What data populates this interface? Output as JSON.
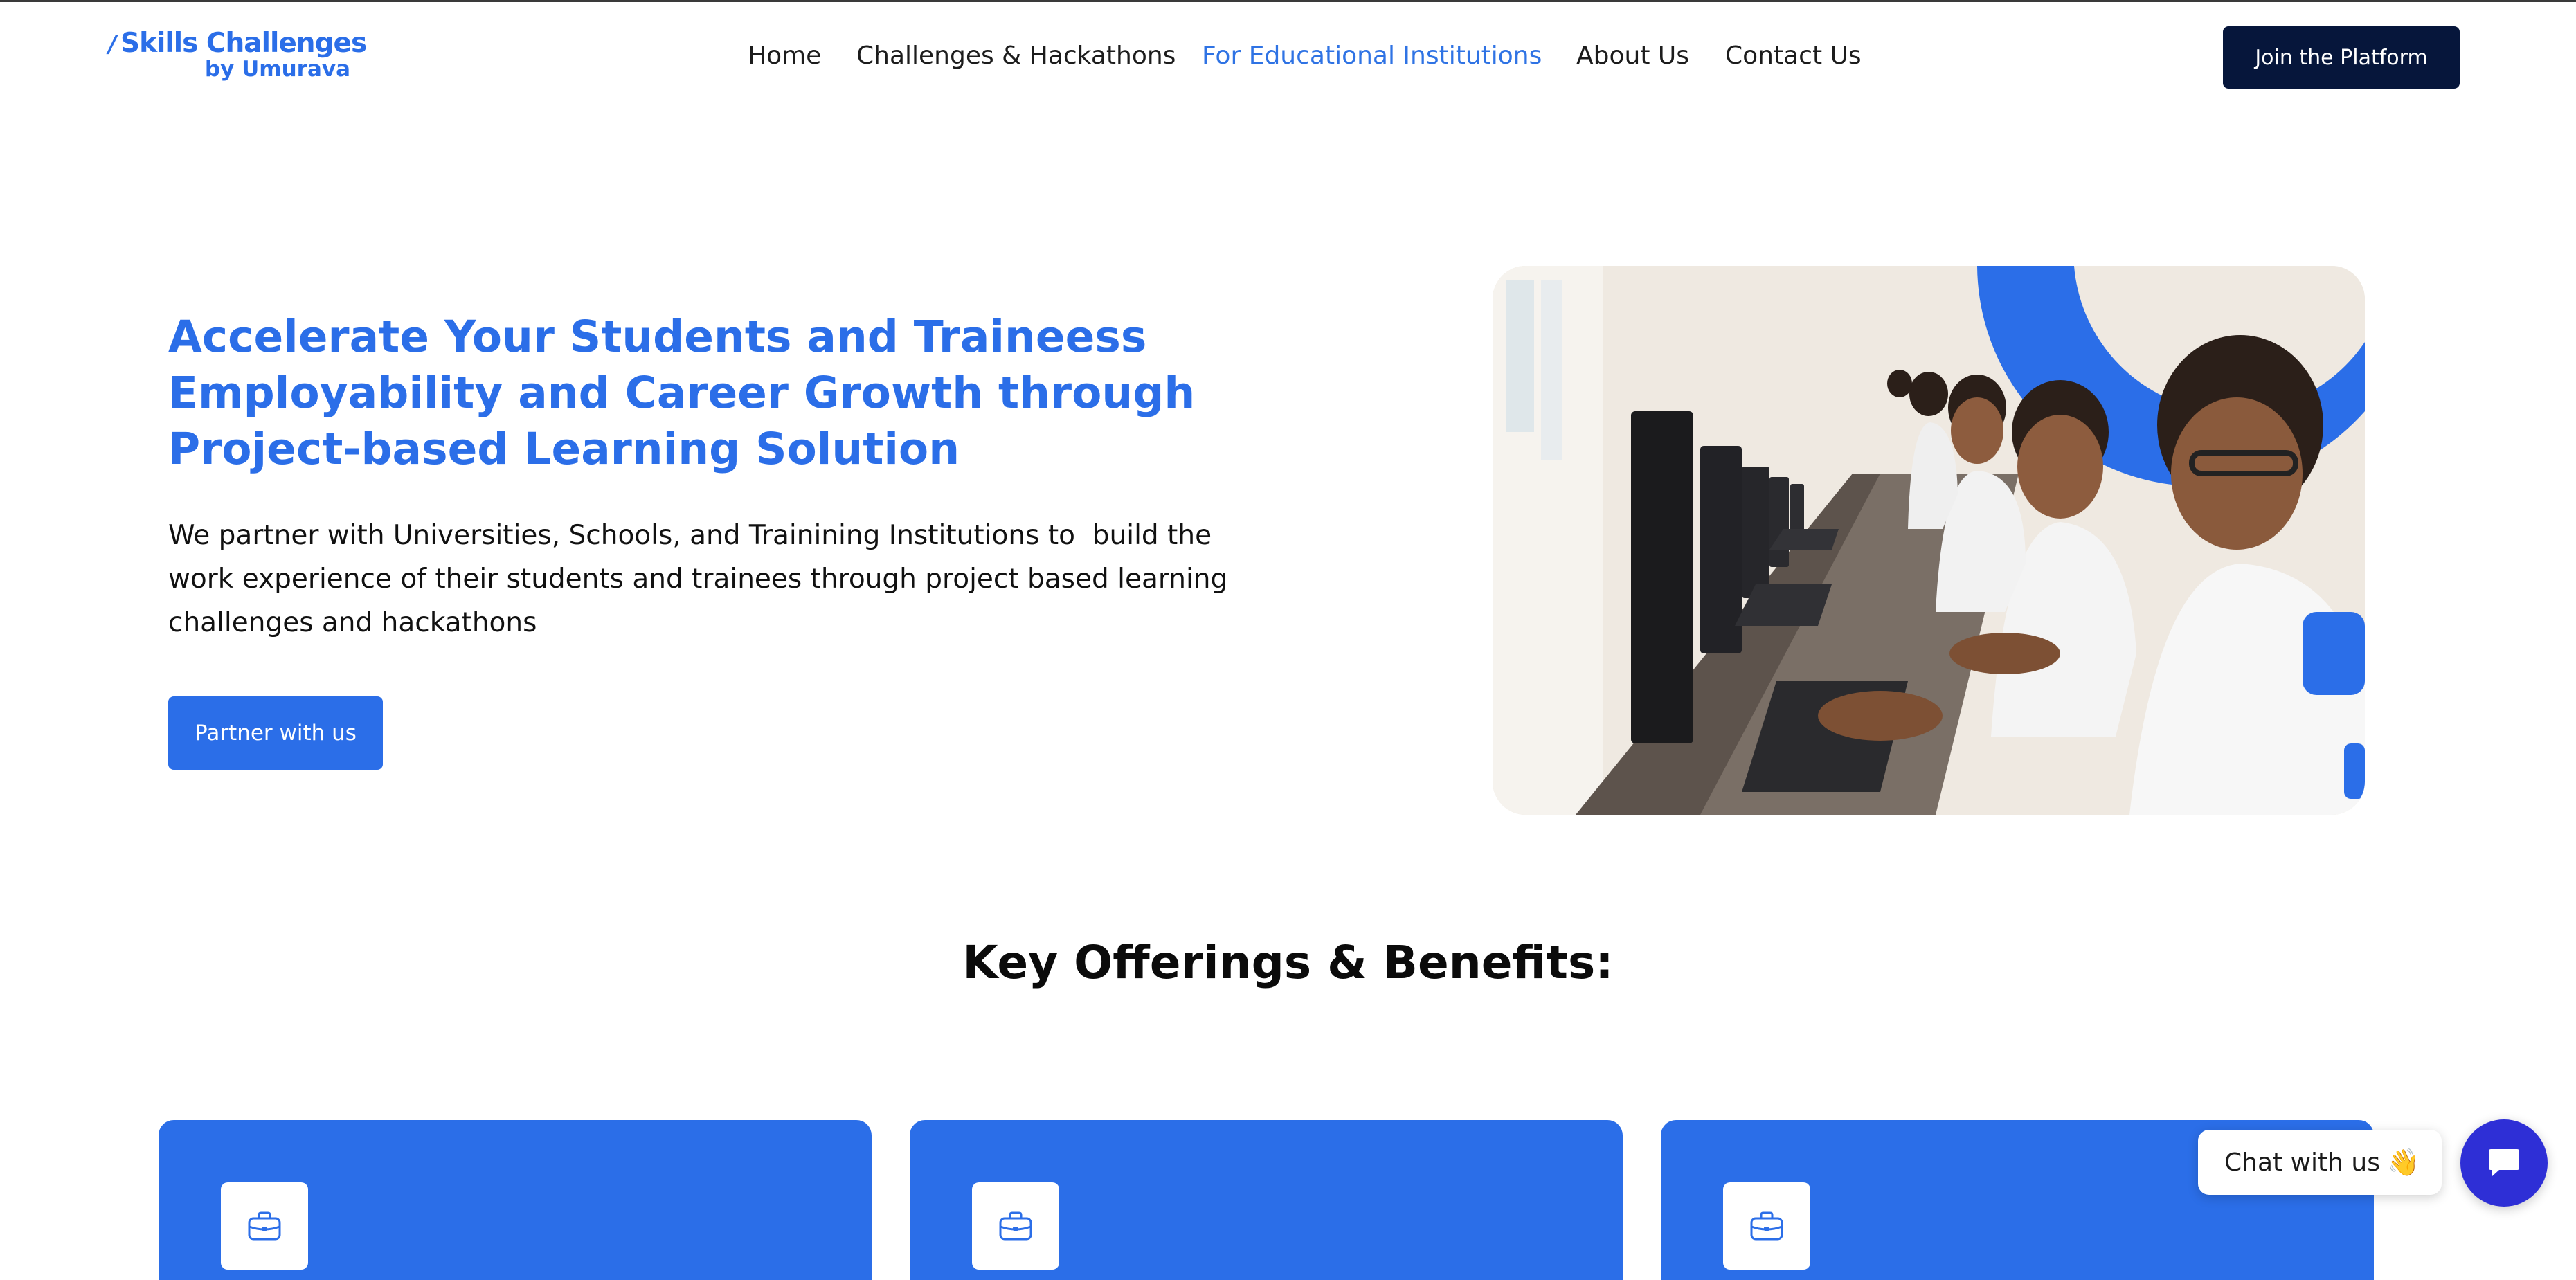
{
  "brand": {
    "title": "Skills Challenges",
    "subtitle": "by Umurava",
    "accent": "#2b6ee8",
    "dark": "#06163b"
  },
  "nav": {
    "items": [
      {
        "label": "Home",
        "active": false
      },
      {
        "label": "Challenges & Hackathons",
        "active": false
      },
      {
        "label": "For Educational Institutions",
        "active": true
      },
      {
        "label": "About Us",
        "active": false
      },
      {
        "label": "Contact Us",
        "active": false
      }
    ],
    "cta": "Join the Platform"
  },
  "hero": {
    "title_lines": [
      "Accelerate Your Students and Traineess",
      "Employability and Career Growth through",
      "Project-based Learning Solution"
    ],
    "description_lines": [
      "We partner with Universities, Schools, and Trainining Institutions to  build the",
      "work experience of their students and trainees through project based learning",
      "challenges and hackathons"
    ],
    "cta": "Partner with us"
  },
  "offerings": {
    "title": "Key Offerings & Benefits:",
    "cards": [
      {
        "icon": "briefcase-icon"
      },
      {
        "icon": "briefcase-icon"
      },
      {
        "icon": "briefcase-icon"
      }
    ]
  },
  "chat": {
    "label": "Chat with us",
    "wave": "👋",
    "button_color": "#2e2fd6"
  }
}
